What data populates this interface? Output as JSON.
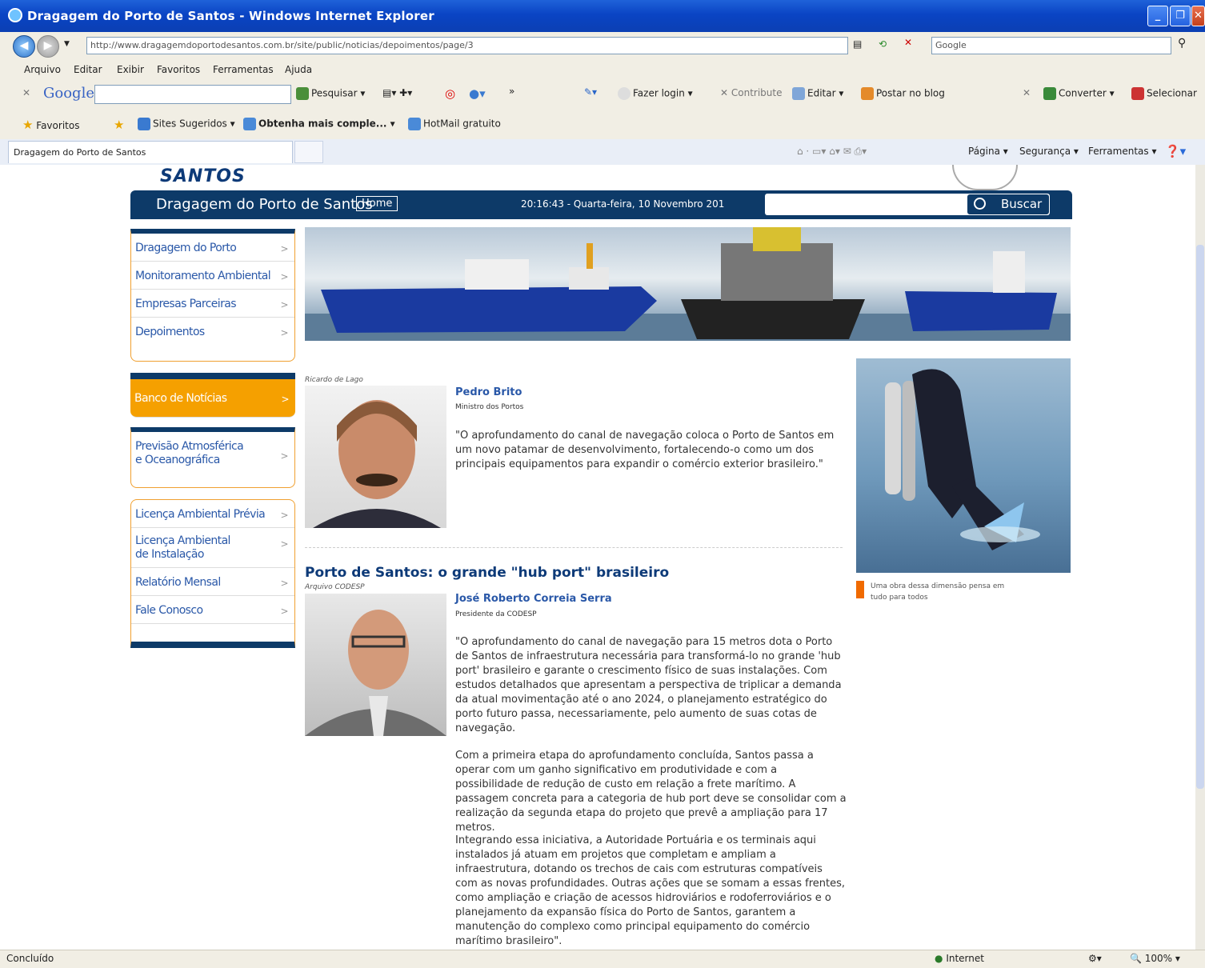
{
  "window": {
    "title": "Dragagem do Porto de Santos - Windows Internet Explorer"
  },
  "browser": {
    "url": "http://www.dragagemdoportodesantos.com.br/site/public/noticias/depoimentos/page/3",
    "search_engine_placeholder": "Google",
    "menu": [
      "Arquivo",
      "Editar",
      "Exibir",
      "Favoritos",
      "Ferramentas",
      "Ajuda"
    ],
    "google_bar": {
      "brand": "Google",
      "search": "Pesquisar",
      "more": "»",
      "login": "Fazer login",
      "contribute": "Contribute",
      "edit": "Editar",
      "blog": "Postar no blog",
      "convert": "Converter",
      "select": "Selecionar"
    },
    "favorites": {
      "label": "Favoritos",
      "items": [
        "Sites Sugeridos",
        "Obtenha mais comple...",
        "HotMail gratuito"
      ]
    },
    "tab": "Dragagem do Porto de Santos",
    "cmd": {
      "page": "Página",
      "security": "Segurança",
      "tools": "Ferramentas"
    },
    "status": {
      "left": "Concluído",
      "zone": "Internet",
      "zoom": "100%"
    }
  },
  "site": {
    "logo": "SANTOS",
    "name": "Dragagem do Porto de Santos",
    "home": "Home",
    "datetime": "20:16:43 - Quarta-feira, 10 Novembro 201",
    "search_button": "Buscar",
    "menu_group1": [
      "Dragagem do Porto",
      "Monitoramento Ambiental",
      "Empresas Parceiras",
      "Depoimentos"
    ],
    "menu_highlight": "Banco de Notícias",
    "menu_group2": [
      "Previsão Atmosférica\ne Oceanográfica"
    ],
    "menu_group3": [
      "Licença Ambiental Prévia",
      "Licença Ambiental\nde Instalação",
      "Relatório Mensal",
      "Fale Conosco"
    ],
    "arrow": ">"
  },
  "content": {
    "photo1_credit": "Ricardo de Lago",
    "quote1_author": "Pedro Brito",
    "quote1_role": "Ministro dos Portos",
    "quote1": "\"O aprofundamento do canal de navegação coloca o Porto de Santos em um novo patamar de desenvolvimento, fortalecendo-o como um dos principais equipamentos para expandir o comércio exterior brasileiro.\"",
    "headline": "Porto de Santos: o grande \"hub port\" brasileiro",
    "photo2_credit": "Arquivo CODESP",
    "quote2_author": "José Roberto Correia Serra",
    "quote2_role": "Presidente da CODESP",
    "para1": "\"O aprofundamento do canal de navegação para 15 metros dota o Porto de Santos de infraestrutura necessária para transformá-lo no grande 'hub port' brasileiro e garante o crescimento físico de suas instalações. Com estudos detalhados que apresentam a perspectiva de triplicar a demanda da atual movimentação até o ano 2024, o planejamento estratégico do porto futuro passa, necessariamente, pelo aumento de suas cotas de navegação.",
    "para2": "Com a primeira etapa do aprofundamento concluída, Santos passa a operar com um ganho significativo em produtividade e com a possibilidade de redução de custo em relação a frete marítimo. A passagem concreta para a categoria de hub port deve se consolidar com a realização da segunda etapa do projeto que prevê a ampliação para 17 metros.",
    "para3": "Integrando essa iniciativa, a Autoridade Portuária e os terminais aqui instalados já atuam em projetos que completam e ampliam a infraestrutura, dotando os trechos de cais com estruturas compatíveis com as novas profundidades. Outras ações que se somam a essas frentes, como ampliação e criação de acessos hidroviários e rodoferroviários e o planejamento da expansão física do Porto de Santos, garantem a manutenção do complexo como principal equipamento do comércio marítimo brasileiro\".",
    "side_caption": "Uma obra dessa dimensão pensa em tudo para todos"
  }
}
